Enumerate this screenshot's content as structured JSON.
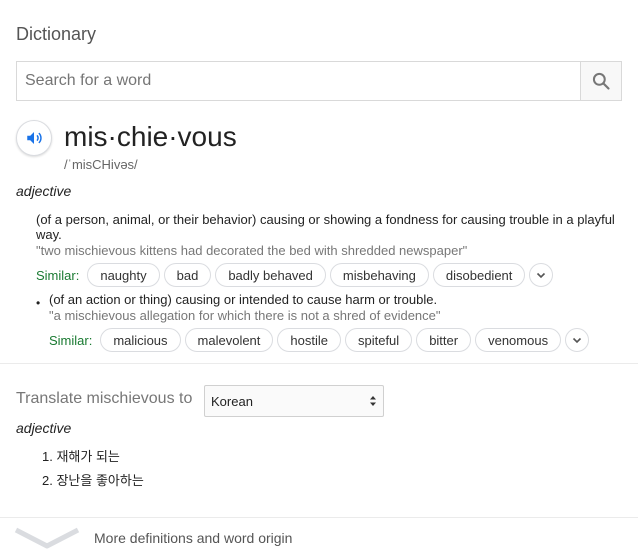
{
  "title": "Dictionary",
  "search": {
    "placeholder": "Search for a word"
  },
  "entry": {
    "word": "mis·chie·vous",
    "pronunciation": "/ˈmisCHivəs/",
    "part_of_speech": "adjective",
    "senses": [
      {
        "definition": "(of a person, animal, or their behavior) causing or showing a fondness for causing trouble in a playful way.",
        "example": "\"two mischievous kittens had decorated the bed with shredded newspaper\"",
        "similar_label": "Similar:",
        "similar": [
          "naughty",
          "bad",
          "badly behaved",
          "misbehaving",
          "disobedient"
        ]
      },
      {
        "bullet": "•",
        "definition": "(of an action or thing) causing or intended to cause harm or trouble.",
        "example": "\"a mischievous allegation for which there is not a shred of evidence\"",
        "similar_label": "Similar:",
        "similar": [
          "malicious",
          "malevolent",
          "hostile",
          "spiteful",
          "bitter",
          "venomous"
        ]
      }
    ]
  },
  "translate": {
    "label": "Translate mischievous to",
    "language": "Korean",
    "part_of_speech": "adjective",
    "items": [
      "1. 재해가 되는",
      "2. 장난을 좋아하는"
    ]
  },
  "more": {
    "label": "More definitions and word origin"
  },
  "colors": {
    "accent_blue": "#1a73e8",
    "similar_green": "#1a7a32"
  }
}
